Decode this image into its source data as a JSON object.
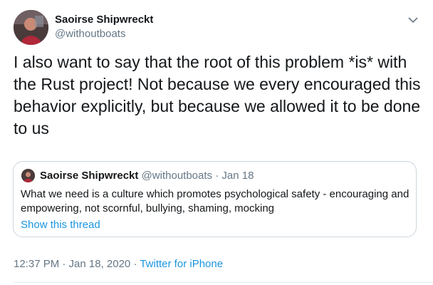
{
  "author": {
    "name": "Saoirse Shipwreckt",
    "handle": "@withoutboats"
  },
  "tweet": {
    "text": "I also want to say that the root of this problem *is* with the Rust project! Not because we every encouraged this behavior explicitly, but because we allowed it to be done to us"
  },
  "quoted": {
    "name": "Saoirse Shipwreckt",
    "handle": "@withoutboats",
    "separator": " · ",
    "date": "Jan 18",
    "text": "What we need is a culture which promotes psychological safety - encouraging and empowering, not scornful, bullying, shaming, mocking",
    "thread_link": "Show this thread"
  },
  "footer": {
    "timestamp": "12:37 PM · Jan 18, 2020",
    "separator": " · ",
    "source": "Twitter for iPhone"
  },
  "icons": {
    "caret": "chevron-down-icon"
  },
  "colors": {
    "link": "#1b95e0",
    "muted": "#657786",
    "border": "#ccd6dd"
  }
}
